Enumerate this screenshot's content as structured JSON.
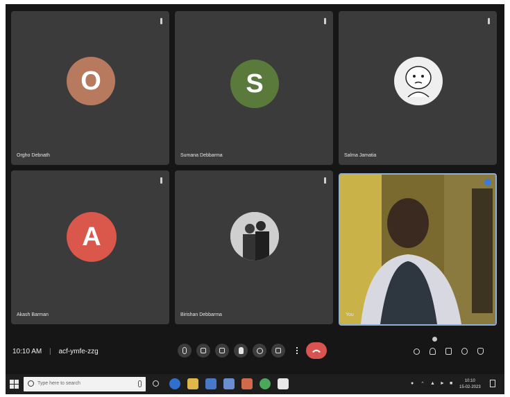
{
  "participants": [
    {
      "name": "Orgho Debnath",
      "initial": "O",
      "avatar_color": "#b87a5e"
    },
    {
      "name": "Sumana Debbarma",
      "initial": "S",
      "avatar_color": "#5a7a3c"
    },
    {
      "name": "Salma Jamatia",
      "initial": "",
      "avatar_type": "cartoon"
    },
    {
      "name": "Akash Barman",
      "initial": "A",
      "avatar_color": "#d9574b"
    },
    {
      "name": "Birishan Debbarma",
      "initial": "",
      "avatar_type": "photo"
    },
    {
      "name": "You",
      "initial": "",
      "avatar_type": "video"
    }
  ],
  "meeting": {
    "time": "10:10 AM",
    "code": "acf-ymfe-zzg"
  },
  "controls": [
    "mic-icon",
    "camera-icon",
    "captions-icon",
    "raise-hand-icon",
    "emoji-icon",
    "present-icon",
    "more-options-icon"
  ],
  "right_controls": [
    "info-icon",
    "people-icon",
    "chat-icon",
    "activities-icon",
    "host-controls-icon"
  ],
  "taskbar": {
    "search_placeholder": "Type here to search",
    "clock_time": "10:10",
    "clock_date": "15-02-2023"
  },
  "colors": {
    "leave_button": "#d9534f",
    "tile_bg": "#3b3b3b"
  }
}
